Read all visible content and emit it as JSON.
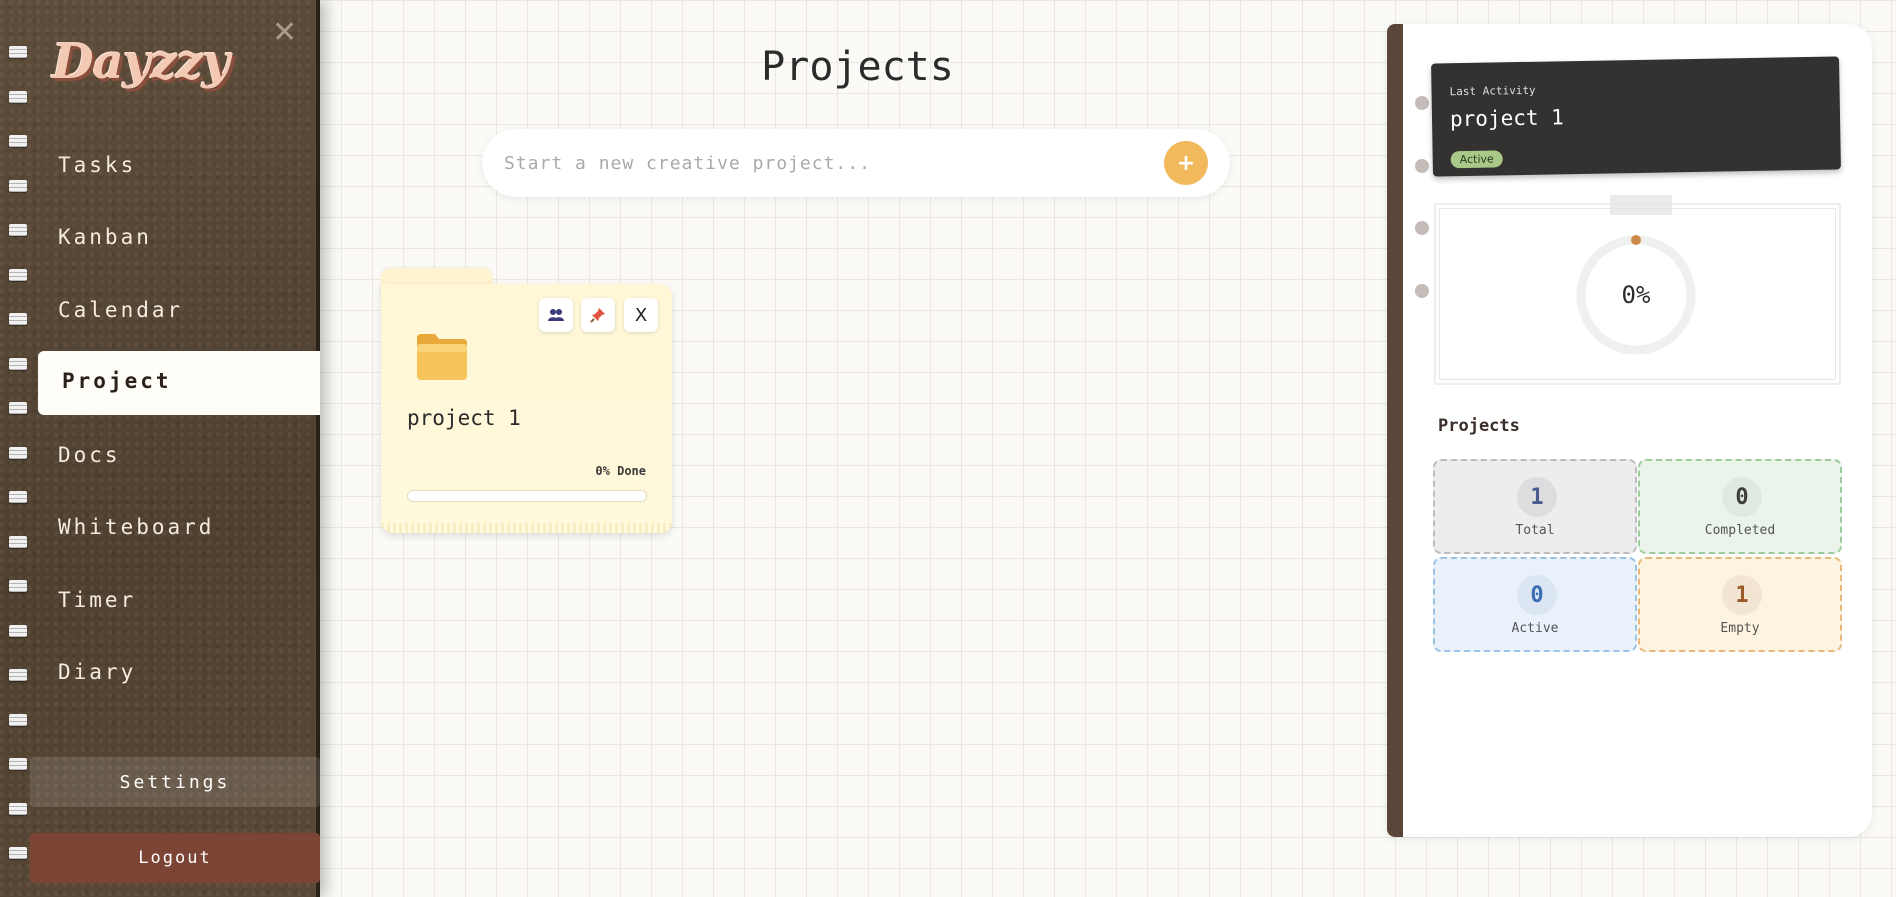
{
  "sidebar": {
    "logo": "Dayzzy",
    "close_glyph": "✕",
    "items": [
      {
        "label": "Tasks"
      },
      {
        "label": "Kanban"
      },
      {
        "label": "Calendar"
      },
      {
        "label": "Project",
        "active": true
      },
      {
        "label": "Docs"
      },
      {
        "label": "Whiteboard"
      },
      {
        "label": "Timer"
      },
      {
        "label": "Diary"
      }
    ],
    "settings_label": "Settings",
    "logout_label": "Logout"
  },
  "main": {
    "title": "Projects",
    "search": {
      "placeholder": "Start a new creative project...",
      "value": "",
      "add_glyph": "+"
    },
    "projects": [
      {
        "name": "project 1",
        "progress_label": "0% Done",
        "progress": 0,
        "close_glyph": "X"
      }
    ]
  },
  "panel": {
    "last_activity": {
      "label": "Last Activity",
      "name": "project 1",
      "status": "Active"
    },
    "progress_text": "0%",
    "progress": 0,
    "stats_title": "Projects",
    "stats": [
      {
        "label": "Total",
        "value": "1",
        "bg": "#ededef",
        "border": "#bdbdbf",
        "numBg": "#dddde0",
        "numColor": "#4a5a8c"
      },
      {
        "label": "Completed",
        "value": "0",
        "bg": "#eaf4ea",
        "border": "#9ccb9c",
        "numBg": "#dfe9df",
        "numColor": "#3f3f3f"
      },
      {
        "label": "Active",
        "value": "0",
        "bg": "#e9f2fb",
        "border": "#9cc2e4",
        "numBg": "#dbe6f2",
        "numColor": "#3b6fb5"
      },
      {
        "label": "Empty",
        "value": "1",
        "bg": "#fdf3e1",
        "border": "#e7b87a",
        "numBg": "#f2e6d2",
        "numColor": "#9a5a2a"
      }
    ]
  },
  "colors": {
    "accent": "#f2b85c",
    "sidebar": "#5b4a38",
    "logout": "#7b4434"
  },
  "icons": [
    "close-icon",
    "add-icon",
    "share-icon",
    "pin-icon",
    "folder-icon"
  ]
}
